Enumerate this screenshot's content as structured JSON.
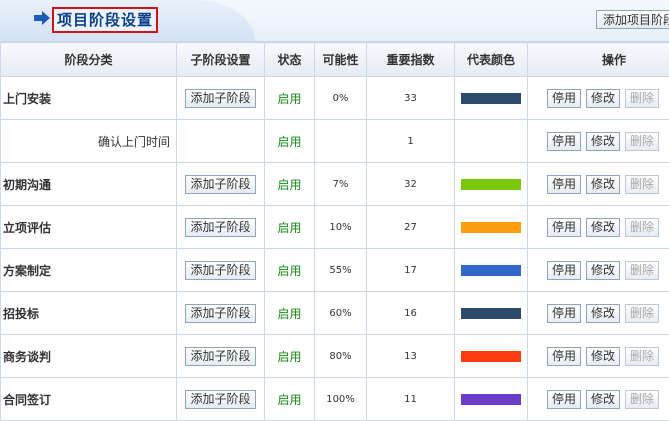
{
  "header": {
    "title": "项目阶段设置",
    "add_button": "添加项目阶段"
  },
  "columns": [
    "阶段分类",
    "子阶段设置",
    "状态",
    "可能性",
    "重要指数",
    "代表颜色",
    "操作"
  ],
  "actions": {
    "add_sub": "添加子阶段",
    "disable": "停用",
    "edit": "修改",
    "delete": "删除"
  },
  "rows": [
    {
      "name": "上门安装",
      "child": false,
      "status": "启用",
      "probability": "0%",
      "importance": "33",
      "color": "#2e4a6b"
    },
    {
      "name": "确认上门时间",
      "child": true,
      "status": "启用",
      "probability": "",
      "importance": "1",
      "color": ""
    },
    {
      "name": "初期沟通",
      "child": false,
      "status": "启用",
      "probability": "7%",
      "importance": "32",
      "color": "#7ac70c"
    },
    {
      "name": "立项评估",
      "child": false,
      "status": "启用",
      "probability": "10%",
      "importance": "27",
      "color": "#ff9f10"
    },
    {
      "name": "方案制定",
      "child": false,
      "status": "启用",
      "probability": "55%",
      "importance": "17",
      "color": "#3268c8"
    },
    {
      "name": "招投标",
      "child": false,
      "status": "启用",
      "probability": "60%",
      "importance": "16",
      "color": "#2e4a6b"
    },
    {
      "name": "商务谈判",
      "child": false,
      "status": "启用",
      "probability": "80%",
      "importance": "13",
      "color": "#ff3c10"
    },
    {
      "name": "合同签订",
      "child": false,
      "status": "启用",
      "probability": "100%",
      "importance": "11",
      "color": "#6a3cc8"
    }
  ]
}
